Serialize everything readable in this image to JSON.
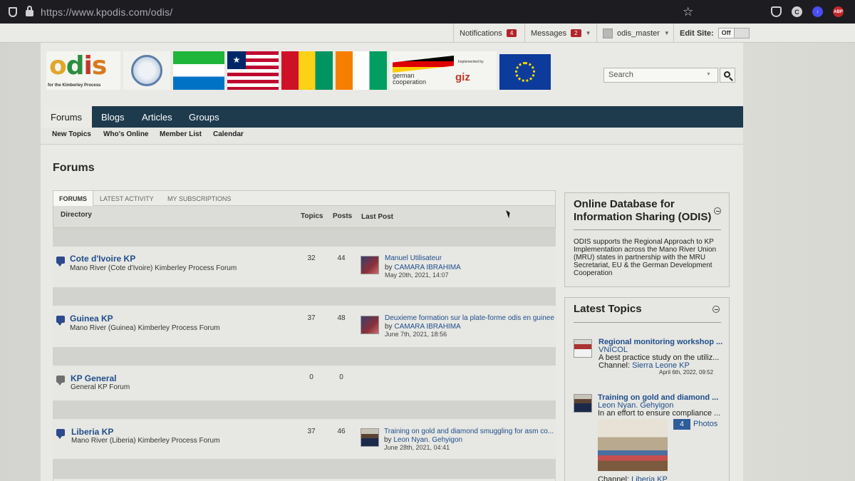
{
  "browser": {
    "url": "https://www.kpodis.com/odis/"
  },
  "topbar": {
    "notifications_label": "Notifications",
    "notifications_count": "4",
    "messages_label": "Messages",
    "messages_count": "2",
    "username": "odis_master",
    "edit_site_label": "Edit Site:",
    "edit_site_state": "Off"
  },
  "banner": {
    "odis_logo_tag": "for the Kimberley Process",
    "partner_line1": "german",
    "partner_line2": "cooperation",
    "implemented_by": "Implemented by",
    "giz": "giz"
  },
  "search": {
    "placeholder": "Search"
  },
  "nav": {
    "tabs": [
      "Forums",
      "Blogs",
      "Articles",
      "Groups"
    ],
    "active": "Forums",
    "subnav": [
      "New Topics",
      "Who's Online",
      "Member List",
      "Calendar"
    ]
  },
  "page": {
    "title": "Forums"
  },
  "forum_tabs": [
    "FORUMS",
    "LATEST ACTIVITY",
    "MY SUBSCRIPTIONS"
  ],
  "columns": {
    "directory": "Directory",
    "topics": "Topics",
    "posts": "Posts",
    "last_post": "Last Post"
  },
  "forums": [
    {
      "name": "Cote d'Ivoire KP",
      "description": "Mano River (Cote d'Ivoire) Kimberley Process Forum",
      "topics": "32",
      "posts": "44",
      "last_post_title": "Manuel Utilisateur",
      "by": "by",
      "last_post_author": "CAMARA IBRAHIMA",
      "last_post_date": "May 20th, 2021, 14:07"
    },
    {
      "name": "Guinea KP",
      "description": "Mano River (Guinea) Kimberley Process Forum",
      "topics": "37",
      "posts": "48",
      "last_post_title": "Deuxieme formation sur la plate-forme odis en guinee",
      "by": "by",
      "last_post_author": "CAMARA IBRAHIMA",
      "last_post_date": "June 7th, 2021, 18:56"
    },
    {
      "name": "KP General",
      "description": "General KP Forum",
      "topics": "0",
      "posts": "0"
    },
    {
      "name": "Liberia KP",
      "description": "Mano River (Liberia) Kimberley Process Forum",
      "topics": "37",
      "posts": "46",
      "last_post_title": "Training on gold and diamond smuggling for asm co...",
      "by": "by",
      "last_post_author": "Leon Nyan. Gehyigon",
      "last_post_date": "June 28th, 2021, 04:41"
    }
  ],
  "sidebar": {
    "odis_title_line1": "Online Database for",
    "odis_title_line2": "Information Sharing (ODIS)",
    "odis_description": "ODIS supports the Regional Approach to KP Implementation across the Mano River Union (MRU) states in partnership with the MRU Secretariat, EU & the German Development Cooperation",
    "latest_title": "Latest Topics",
    "topics": [
      {
        "title": "Regional monitoring workshop ...",
        "author": "VNICOL",
        "snippet": "A best practice study on the utiliz...",
        "channel_label": "Channel:",
        "channel": "Sierra Leone KP",
        "date": "April 6th, 2022, 09:52"
      },
      {
        "title": "Training on gold and diamond ...",
        "author": "Leon Nyan. Gehyigon",
        "snippet": "In an effort to ensure compliance ...",
        "photo_count": "4",
        "photos_label": "Photos",
        "channel_label": "Channel:",
        "channel": "Liberia KP"
      }
    ]
  },
  "colors": {
    "nav_bg": "#1e3a4d",
    "link": "#1f4e8c",
    "badge": "#b3232a"
  }
}
